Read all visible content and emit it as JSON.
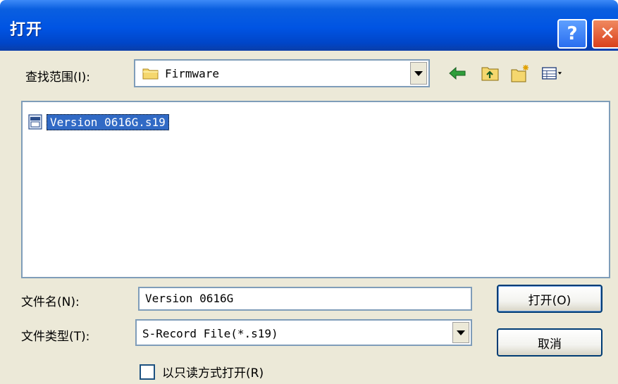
{
  "window": {
    "title": "打开"
  },
  "titlebar": {
    "help_label": "?",
    "close_label": "✕"
  },
  "lookin": {
    "label": "查找范围(I):",
    "value": "Firmware"
  },
  "files": [
    {
      "name": "Version 0616G.s19"
    }
  ],
  "filename": {
    "label": "文件名(N):",
    "value": "Version 0616G"
  },
  "filetype": {
    "label": "文件类型(T):",
    "value": "S-Record File(*.s19)"
  },
  "buttons": {
    "open_label": "打开(O)",
    "cancel_label": "取消"
  },
  "readonly": {
    "label": "以只读方式打开(R)",
    "checked": false
  },
  "colors": {
    "titlebar": "#0054e3",
    "selection": "#316ac5",
    "dialog_bg": "#ece9d8",
    "border": "#7f9db9"
  },
  "icons": [
    "folder-icon",
    "back-arrow-icon",
    "up-folder-icon",
    "new-folder-icon",
    "views-menu-icon",
    "s19-file-icon",
    "help-icon",
    "close-icon"
  ]
}
